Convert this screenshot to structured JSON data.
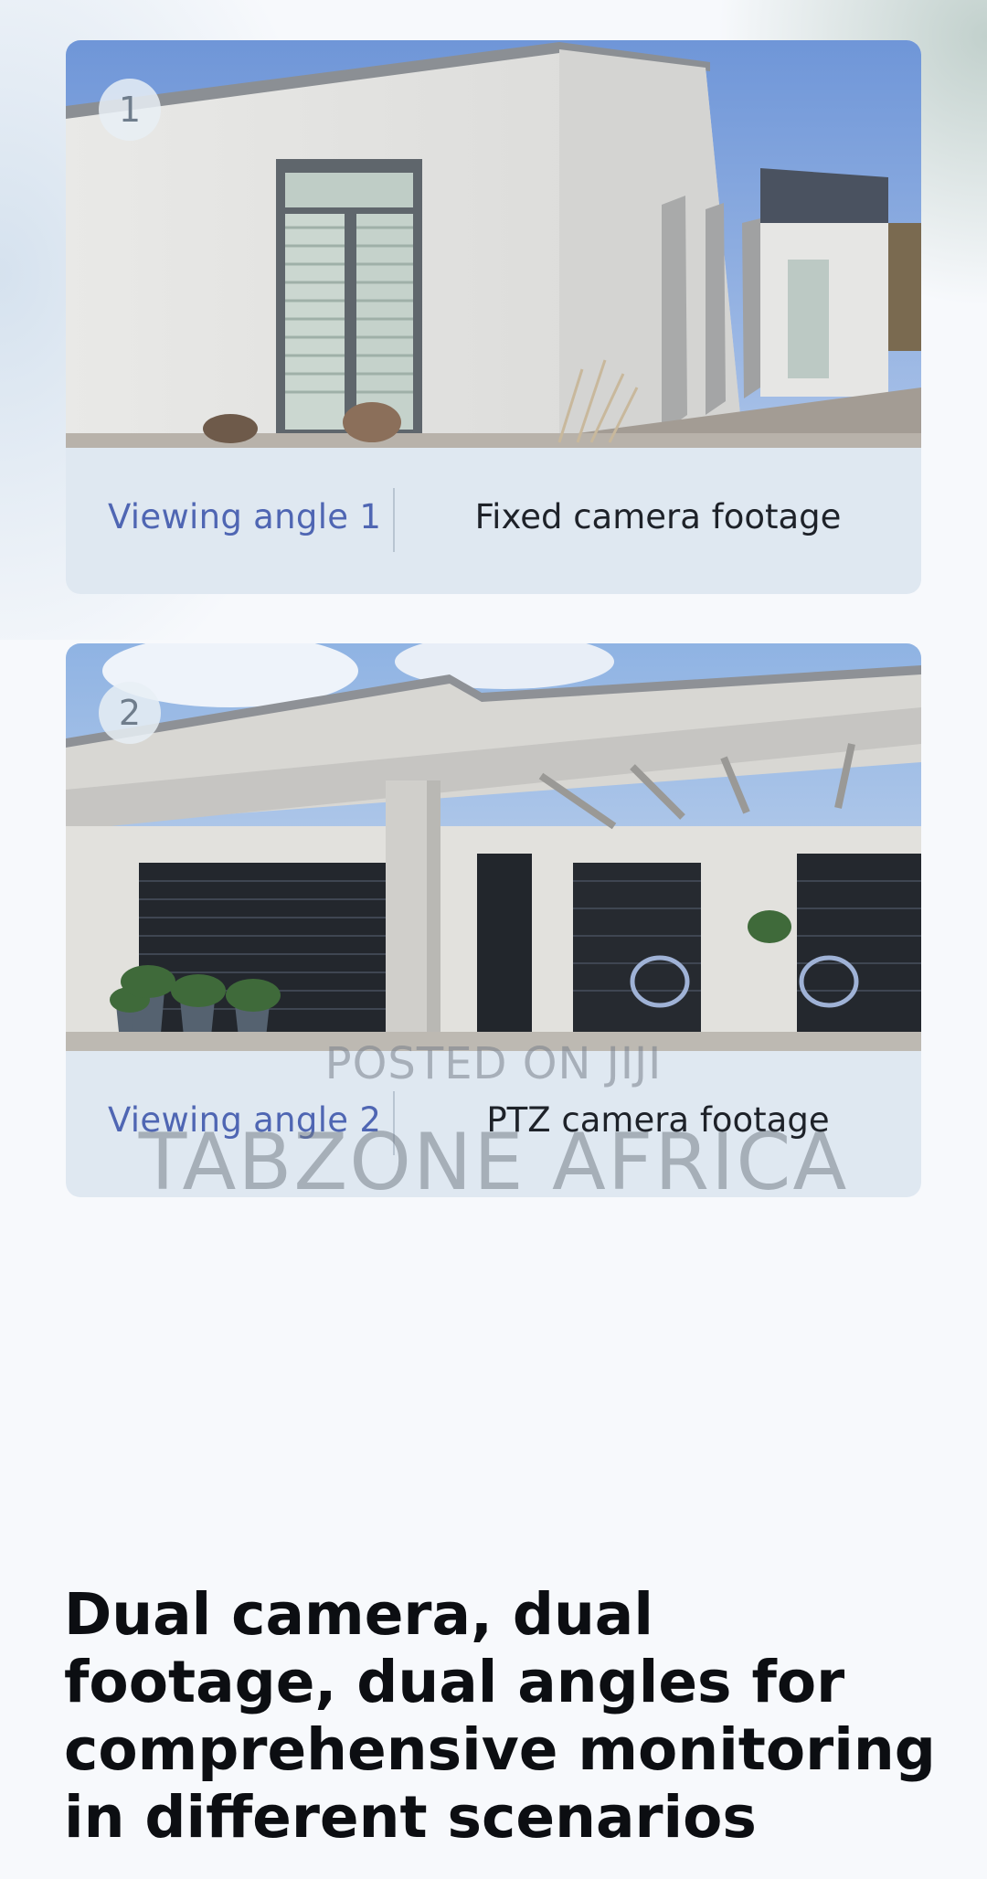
{
  "cards": [
    {
      "number": "1",
      "angle_label": "Viewing angle 1",
      "footage_label": "Fixed camera footage"
    },
    {
      "number": "2",
      "angle_label": "Viewing angle 2",
      "footage_label": "PTZ camera footage"
    }
  ],
  "watermark": {
    "line1": "POSTED ON JIJI",
    "line2": "TABZONE AFRICA"
  },
  "headline": "Dual camera, dual footage, dual angles for comprehensive monitoring in different scenarios",
  "colors": {
    "accent": "#4f66b3",
    "card_bg": "#dfe8f1",
    "text": "#0c0e12"
  }
}
